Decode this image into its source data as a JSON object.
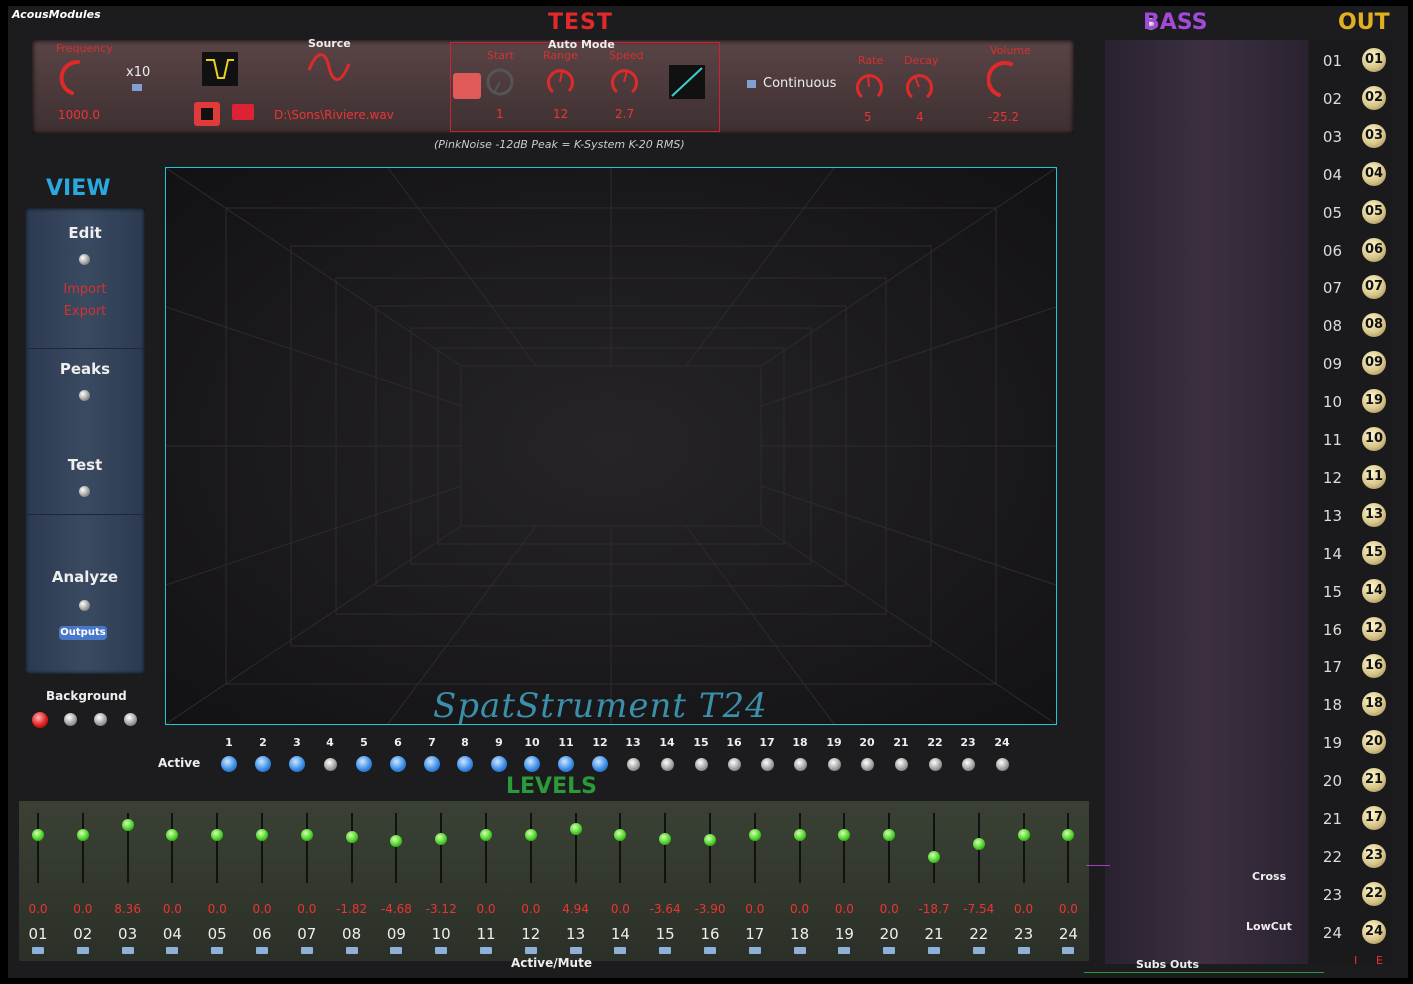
{
  "brand": "AcousModules",
  "test": {
    "title": "TEST",
    "frequency_label": "Frequency",
    "frequency_value": "1000.0",
    "x10_label": "x10",
    "source_label": "Source",
    "file_path": "D:\\Sons\\Riviere.wav",
    "auto_mode_label": "Auto Mode",
    "start_label": "Start",
    "start_value": "1",
    "range_label": "Range",
    "range_value": "12",
    "speed_label": "Speed",
    "speed_value": "2.7",
    "continuous_label": "Continuous",
    "rate_label": "Rate",
    "rate_value": "5",
    "decay_label": "Decay",
    "decay_value": "4",
    "volume_label": "Volume",
    "volume_value": "-25.2",
    "note": "(PinkNoise -12dB Peak = K-System K-20 RMS)"
  },
  "view": {
    "title": "VIEW",
    "edit_label": "Edit",
    "import_label": "Import",
    "export_label": "Export",
    "peaks_label": "Peaks",
    "test_label": "Test",
    "analyze_label": "Analyze",
    "outputs_label": "Outputs",
    "background_label": "Background"
  },
  "canvas": {
    "product_name": "SpatStrument T24"
  },
  "active": {
    "label": "Active",
    "channels": [
      "1",
      "2",
      "3",
      "4",
      "5",
      "6",
      "7",
      "8",
      "9",
      "10",
      "11",
      "12",
      "13",
      "14",
      "15",
      "16",
      "17",
      "18",
      "19",
      "20",
      "21",
      "22",
      "23",
      "24"
    ],
    "states": [
      true,
      true,
      true,
      false,
      true,
      true,
      true,
      true,
      true,
      true,
      true,
      true,
      false,
      false,
      false,
      false,
      false,
      false,
      false,
      false,
      false,
      false,
      false,
      false
    ]
  },
  "levels": {
    "title": "LEVELS",
    "values": [
      "0.0",
      "0.0",
      "8.36",
      "0.0",
      "0.0",
      "0.0",
      "0.0",
      "-1.82",
      "-4.68",
      "-3.12",
      "0.0",
      "0.0",
      "4.94",
      "0.0",
      "-3.64",
      "-3.90",
      "0.0",
      "0.0",
      "0.0",
      "0.0",
      "-18.7",
      "-7.54",
      "0.0",
      "0.0"
    ],
    "levels_db": [
      0,
      0,
      8.36,
      0,
      0,
      0,
      0,
      -1.82,
      -4.68,
      -3.12,
      0,
      0,
      4.94,
      0,
      -3.64,
      -3.9,
      0,
      0,
      0,
      0,
      -18.7,
      -7.54,
      0,
      0
    ],
    "channels": [
      "01",
      "02",
      "03",
      "04",
      "05",
      "06",
      "07",
      "08",
      "09",
      "10",
      "11",
      "12",
      "13",
      "14",
      "15",
      "16",
      "17",
      "18",
      "19",
      "20",
      "21",
      "22",
      "23",
      "24"
    ],
    "active_mute_label": "Active/Mute"
  },
  "bass": {
    "title": "BASS",
    "cross_label": "Cross",
    "lowcut_label": "LowCut",
    "subs_outs_label": "Subs Outs"
  },
  "out": {
    "title": "OUT",
    "numbers": [
      "01",
      "02",
      "03",
      "04",
      "05",
      "06",
      "07",
      "08",
      "09",
      "10",
      "11",
      "12",
      "13",
      "14",
      "15",
      "16",
      "17",
      "18",
      "19",
      "20",
      "21",
      "22",
      "23",
      "24"
    ],
    "assigned": [
      "01",
      "02",
      "03",
      "04",
      "05",
      "06",
      "07",
      "08",
      "09",
      "19",
      "10",
      "11",
      "13",
      "15",
      "14",
      "12",
      "16",
      "18",
      "20",
      "21",
      "17",
      "23",
      "22",
      "24"
    ],
    "footer_i": "I",
    "footer_e": "E"
  },
  "colors": {
    "test_red": "#e02a2a",
    "view_blue": "#2aa9e0",
    "levels_green": "#2a9a3a",
    "bass_purple": "#a24ad8",
    "out_gold": "#e0b020"
  }
}
